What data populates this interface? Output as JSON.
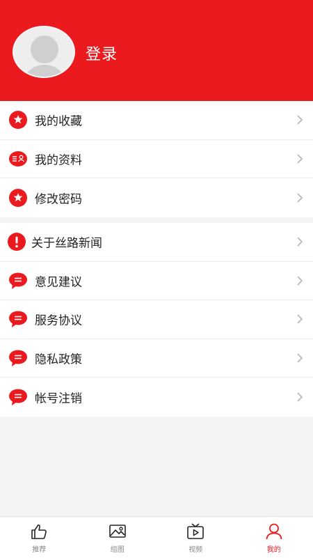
{
  "header": {
    "login_label": "登录"
  },
  "menu_group_1": [
    {
      "label": "我的收藏",
      "icon": "star-icon"
    },
    {
      "label": "我的资料",
      "icon": "profile-card-icon"
    },
    {
      "label": "修改密码",
      "icon": "star-icon"
    }
  ],
  "menu_group_2": [
    {
      "label": "关于丝路新闻",
      "icon": "exclamation-icon"
    },
    {
      "label": "意见建议",
      "icon": "chat-bubble-icon"
    },
    {
      "label": "服务协议",
      "icon": "chat-bubble-icon"
    },
    {
      "label": "隐私政策",
      "icon": "chat-bubble-icon"
    },
    {
      "label": "帐号注销",
      "icon": "chat-bubble-icon"
    }
  ],
  "tabbar": {
    "tabs": [
      {
        "label": "推荐",
        "icon": "thumbs-up-icon",
        "active": false
      },
      {
        "label": "组图",
        "icon": "image-icon",
        "active": false
      },
      {
        "label": "视频",
        "icon": "tv-play-icon",
        "active": false
      },
      {
        "label": "我的",
        "icon": "user-icon",
        "active": true
      }
    ]
  },
  "colors": {
    "brand": "#ea1a1e",
    "background": "#f4f4f6",
    "inactive_tab": "#888888"
  }
}
